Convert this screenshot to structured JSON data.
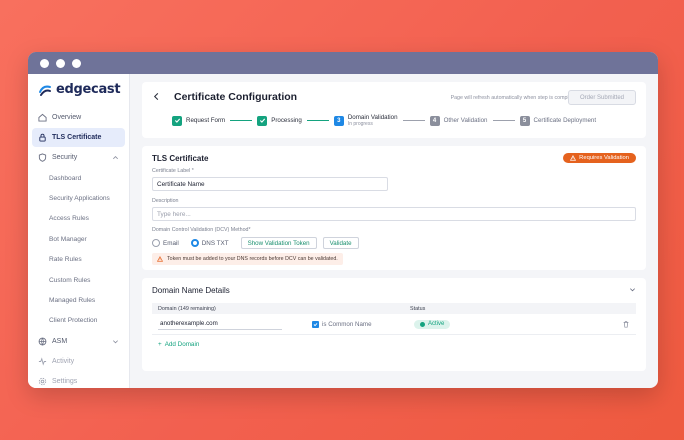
{
  "brand": {
    "logo_text": "edgecast"
  },
  "sidebar": {
    "items": [
      {
        "label": "Overview"
      },
      {
        "label": "TLS Certificate"
      },
      {
        "label": "Security"
      },
      {
        "label": "Dashboard"
      },
      {
        "label": "Security Applications"
      },
      {
        "label": "Access Rules"
      },
      {
        "label": "Bot Manager"
      },
      {
        "label": "Rate Rules"
      },
      {
        "label": "Custom Rules"
      },
      {
        "label": "Managed Rules"
      },
      {
        "label": "Client Protection"
      },
      {
        "label": "ASM"
      },
      {
        "label": "Activity"
      },
      {
        "label": "Settings"
      }
    ]
  },
  "header": {
    "title": "Certificate Configuration",
    "refresh_note": "Page will refresh automatically when step is complete",
    "order_button": "Order Submitted"
  },
  "stepper": {
    "steps": [
      {
        "label": "Request Form"
      },
      {
        "label": "Processing"
      },
      {
        "number": "3",
        "label": "Domain Validation",
        "sub": "In progress"
      },
      {
        "number": "4",
        "label": "Other Validation"
      },
      {
        "number": "5",
        "label": "Certificate Deployment"
      }
    ]
  },
  "tls": {
    "title": "TLS Certificate",
    "badge": "Requires Validation",
    "label_field": {
      "label": "Certificate Label *",
      "value": "Certificate Name"
    },
    "description": {
      "label": "Description",
      "placeholder": "Type here..."
    },
    "dcv": {
      "label": "Domain Control Validation (DCV) Method*",
      "options": [
        "Email",
        "DNS TXT"
      ],
      "show_token": "Show Validation Token",
      "validate": "Validate",
      "warning": "Token must be added to your DNS records before DCV can be validated."
    }
  },
  "domains": {
    "title": "Domain Name Details",
    "col_domain": "Domain (149 remaining)",
    "col_status": "Status",
    "rows": [
      {
        "domain": "anotherexample.com",
        "common_name": "is Common Name",
        "status": "Active"
      }
    ],
    "add_label": "Add Domain"
  },
  "colors": {
    "accent_green": "#14a37f",
    "accent_blue": "#1e88e5",
    "warning_orange": "#e5621e",
    "titlebar": "#6f7399"
  }
}
